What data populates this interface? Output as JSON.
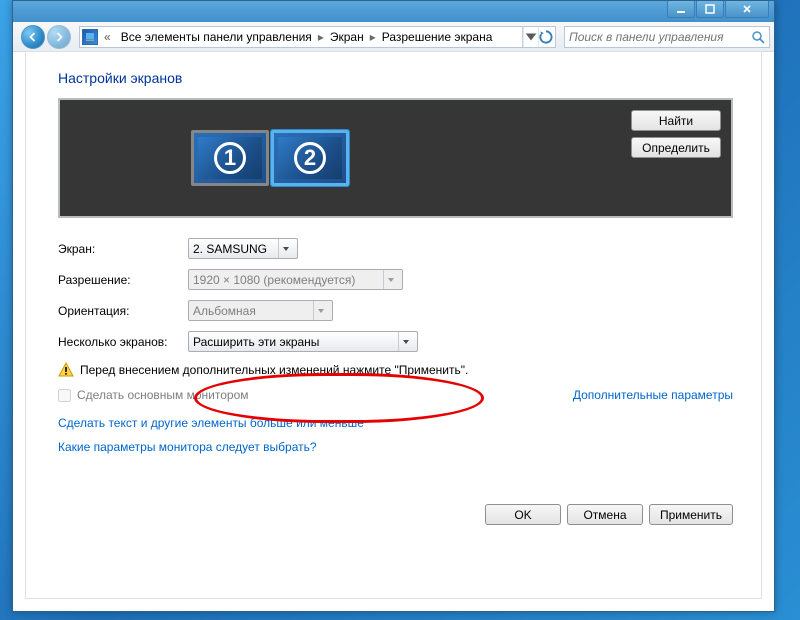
{
  "titlebar": {},
  "breadcrumb": {
    "allItems": "Все элементы панели управления",
    "screen": "Экран",
    "resolution": "Разрешение экрана"
  },
  "search": {
    "placeholder": "Поиск в панели управления"
  },
  "heading": "Настройки экранов",
  "monitors": {
    "n1": "1",
    "n2": "2"
  },
  "sideBtns": {
    "find": "Найти",
    "identify": "Определить"
  },
  "labels": {
    "screen": "Экран:",
    "resolution": "Разрешение:",
    "orientation": "Ориентация:",
    "multiple": "Несколько экранов:"
  },
  "fields": {
    "screen": "2. SAMSUNG",
    "resolution": "1920 × 1080 (рекомендуется)",
    "orientation": "Альбомная",
    "multiple": "Расширить эти экраны"
  },
  "warning": "Перед внесением дополнительных изменений нажмите \"Применить\".",
  "cbPrimary": "Сделать основным монитором",
  "advLink": "Дополнительные параметры",
  "link1": "Сделать текст и другие элементы больше или меньше",
  "link2": "Какие параметры монитора следует выбрать?",
  "footer": {
    "ok": "OK",
    "cancel": "Отмена",
    "apply": "Применить"
  }
}
